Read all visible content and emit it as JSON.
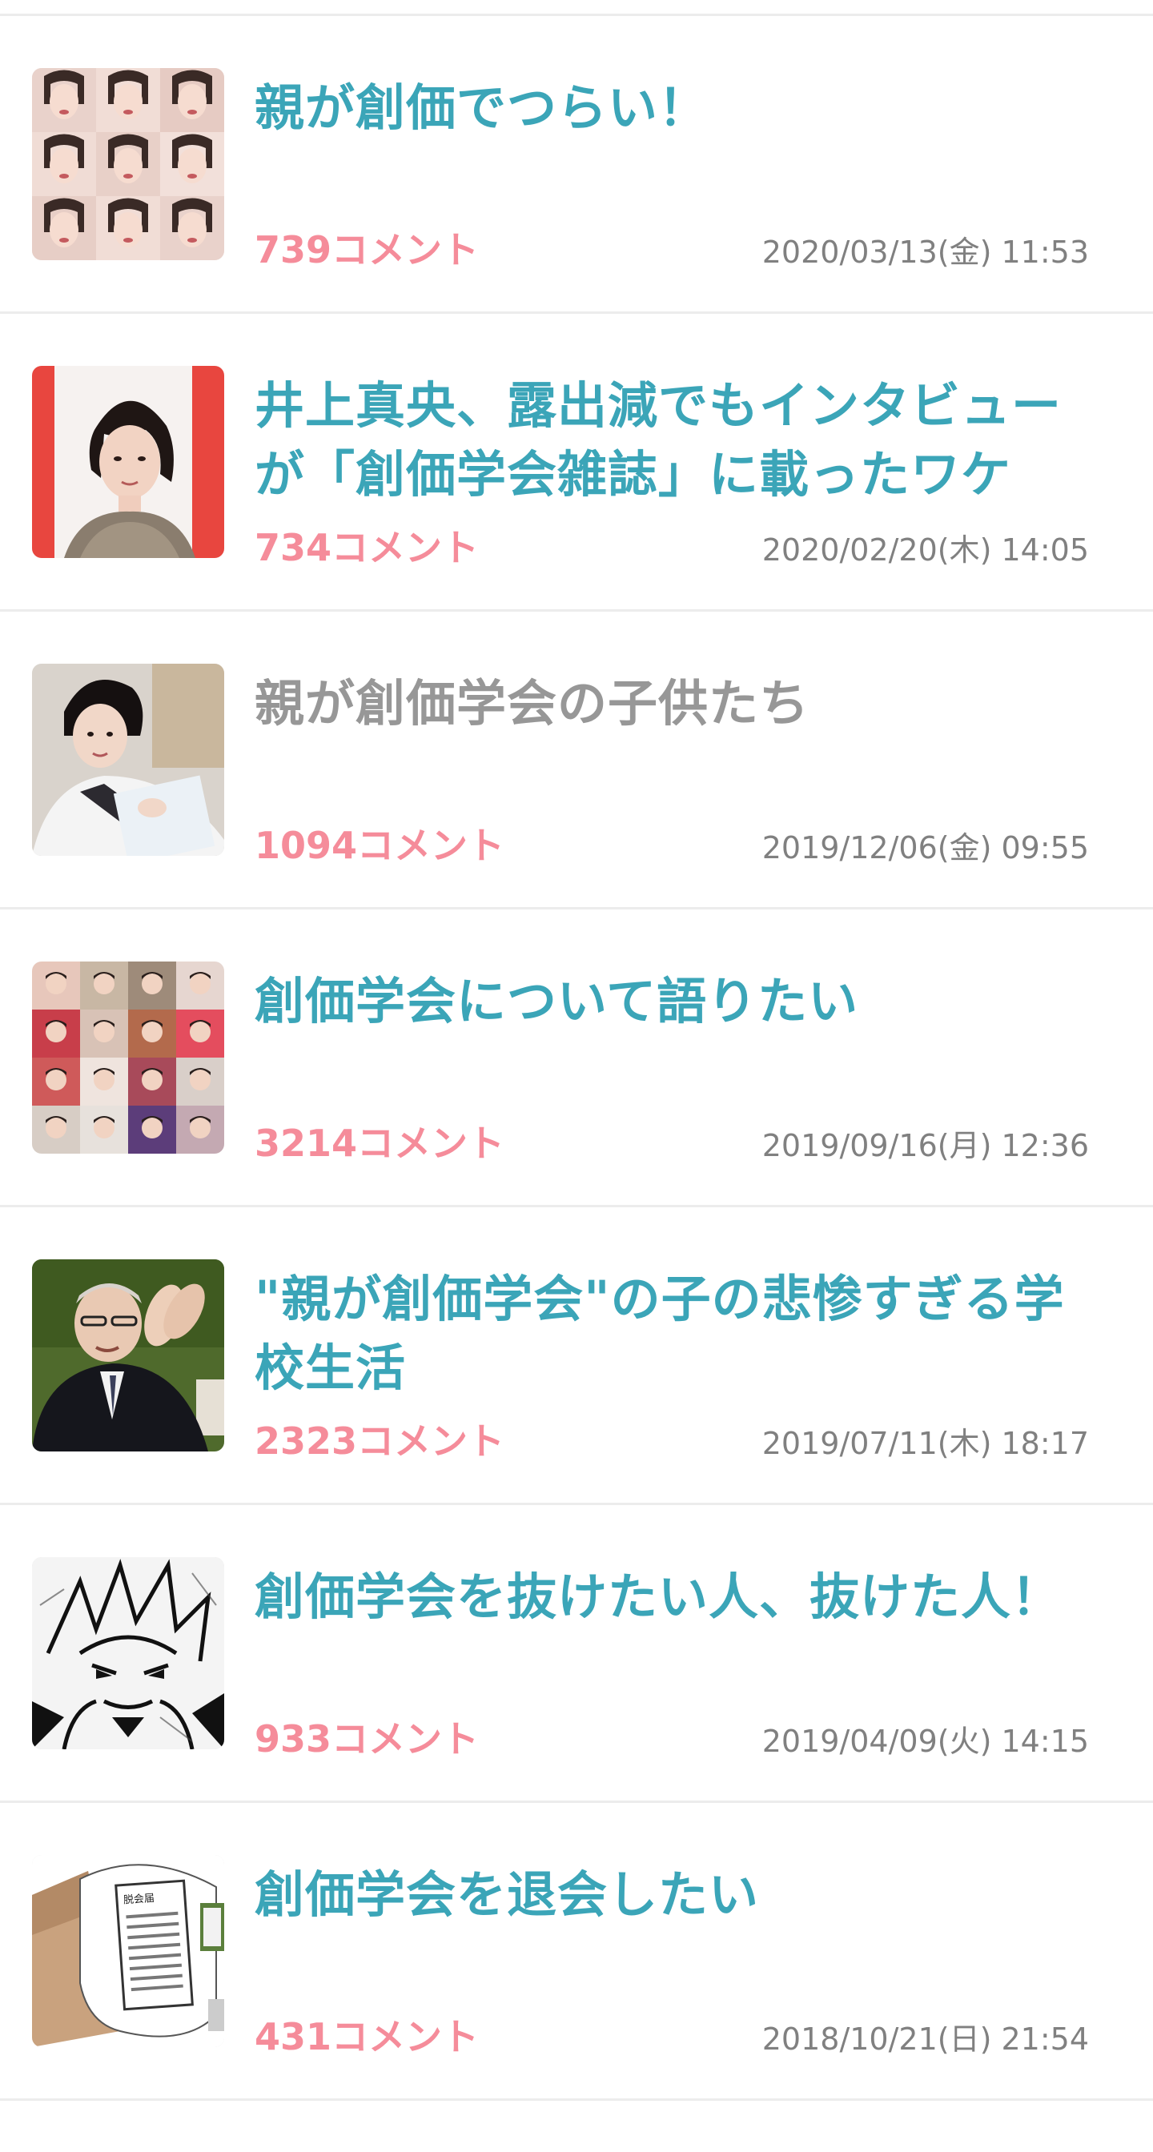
{
  "items": [
    {
      "title": "親が創価でつらい！",
      "comments": "739コメント",
      "date": "2020/03/13(金) 11:53",
      "visited": false,
      "thumb": "photo-grid-women"
    },
    {
      "title": "井上真央、露出減でもインタビューが「創価学会雑誌」に載ったワケ",
      "comments": "734コメント",
      "date": "2020/02/20(木) 14:05",
      "visited": false,
      "thumb": "actress-portrait"
    },
    {
      "title": "親が創価学会の子供たち",
      "comments": "1094コメント",
      "date": "2019/12/06(金) 09:55",
      "visited": true,
      "thumb": "girl-photo"
    },
    {
      "title": "創価学会について語りたい",
      "comments": "3214コメント",
      "date": "2019/09/16(月) 12:36",
      "visited": false,
      "thumb": "celebrity-collage"
    },
    {
      "title": "\"親が創価学会\"の子の悲惨すぎる学校生活",
      "comments": "2323コメント",
      "date": "2019/07/11(木) 18:17",
      "visited": false,
      "thumb": "elderly-man-clapping"
    },
    {
      "title": "創価学会を抜けたい人、抜けた人！",
      "comments": "933コメント",
      "date": "2019/04/09(火) 14:15",
      "visited": false,
      "thumb": "manga-character"
    },
    {
      "title": "創価学会を退会したい",
      "comments": "431コメント",
      "date": "2018/10/21(日) 21:54",
      "visited": false,
      "thumb": "withdrawal-form-illustration",
      "thumb_text": "脱会届"
    }
  ]
}
